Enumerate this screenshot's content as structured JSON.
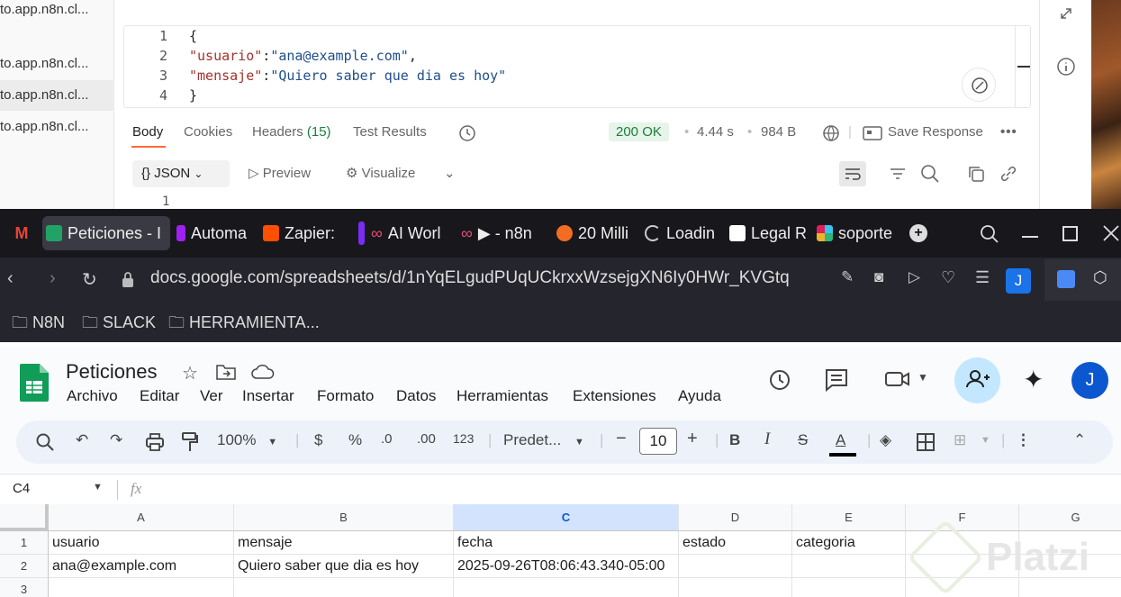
{
  "api_client": {
    "sidebar_rows": [
      "to.app.n8n.cl...",
      "to.app.n8n.cl...",
      "to.app.n8n.cl...",
      "to.app.n8n.cl..."
    ],
    "code_lines": [
      {
        "n": "1",
        "text": "{"
      },
      {
        "n": "2",
        "key": "\"usuario\"",
        "value": "\"ana@example.com\""
      },
      {
        "n": "3",
        "key": "\"mensaje\"",
        "value": "\"Quiero saber que dia es hoy\""
      },
      {
        "n": "4",
        "text": "}"
      }
    ],
    "response_tabs": {
      "body": "Body",
      "cookies": "Cookies",
      "headers": "Headers",
      "headers_count": "(15)",
      "tests": "Test Results"
    },
    "status": "200 OK",
    "time": "4.44 s",
    "size": "984 B",
    "save_response": "Save Response",
    "format": "JSON",
    "preview": "Preview",
    "visualize": "Visualize",
    "line_peek": "1"
  },
  "browser": {
    "tabs": [
      {
        "label": "Peticiones - I",
        "color": "#21a366"
      },
      {
        "label": "Automa",
        "color": "#a020f0"
      },
      {
        "label": "Zapier:",
        "color": "#ff4f00"
      },
      {
        "label": "AI Worl",
        "color": "#ea4b71"
      },
      {
        "label": "▶ - n8n",
        "color": "#ea4b71"
      },
      {
        "label": "20 Milli",
        "color": "#f26d21"
      },
      {
        "label": "Loadin",
        "color": "#cccccc"
      },
      {
        "label": "Legal R",
        "color": "#ffffff"
      },
      {
        "label": "soporte",
        "color": "#e01e5a"
      }
    ],
    "url": "docs.google.com/spreadsheets/d/1nYqELgudPUqUCkrxxWzsejgXN6Iy0HWr_KVGtq",
    "profile_initial": "J",
    "bookmarks": [
      "N8N",
      "SLACK",
      "HERRAMIENTA..."
    ]
  },
  "sheets": {
    "title": "Peticiones",
    "menus": [
      "Archivo",
      "Editar",
      "Ver",
      "Insertar",
      "Formato",
      "Datos",
      "Herramientas",
      "Extensiones",
      "Ayuda"
    ],
    "zoom": "100%",
    "currency": "$",
    "percent": "%",
    "dec_less": ".0",
    "dec_more": ".00",
    "number_fmt": "123",
    "font": "Predet...",
    "font_size": "10",
    "name_box": "C4",
    "fx": "fx",
    "profile_initial": "J",
    "columns": [
      "A",
      "B",
      "C",
      "D",
      "E",
      "F",
      "G"
    ],
    "rows": [
      {
        "n": "1",
        "cells": [
          "usuario",
          "mensaje",
          "fecha",
          "estado",
          "categoria",
          "",
          ""
        ]
      },
      {
        "n": "2",
        "cells": [
          "ana@example.com",
          "Quiero saber que dia es hoy",
          "2025-09-26T08:06:43.340-05:00",
          "",
          "",
          "",
          ""
        ]
      },
      {
        "n": "3",
        "cells": [
          "",
          "",
          "",
          "",
          "",
          "",
          ""
        ]
      }
    ],
    "watermark": "Platzi"
  }
}
